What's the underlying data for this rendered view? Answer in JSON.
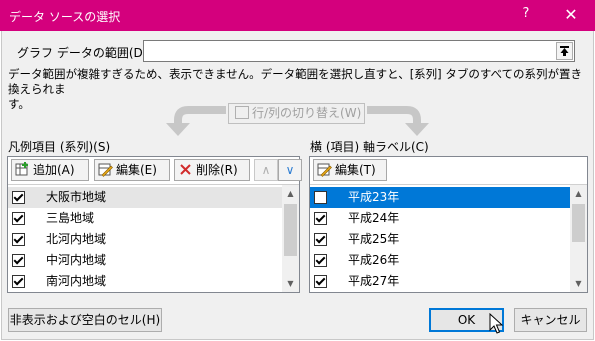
{
  "window": {
    "title": "データ ソースの選択",
    "help_label": "?",
    "close_label": "✕"
  },
  "range": {
    "label": "グラフ データの範囲(D):",
    "value": "",
    "collapse_icon": "collapse-dialog-icon"
  },
  "warning": {
    "line1": "データ範囲が複雑すぎるため、表示できません。データ範囲を選択し直すと、[系列] タブのすべての系列が置き換えられま",
    "line2": "す。"
  },
  "switch_button": {
    "label": "行/列の切り替え(W)"
  },
  "series": {
    "label": "凡例項目 (系列)(S)",
    "add_label": "追加(A)",
    "edit_label": "編集(E)",
    "delete_label": "削除(R)",
    "up_label": "∧",
    "down_label": "∨",
    "items": [
      {
        "label": "大阪市地域",
        "checked": true
      },
      {
        "label": "三島地域",
        "checked": true
      },
      {
        "label": "北河内地域",
        "checked": true
      },
      {
        "label": "中河内地域",
        "checked": true
      },
      {
        "label": "南河内地域",
        "checked": true
      }
    ]
  },
  "categories": {
    "label": "横 (項目) 軸ラベル(C)",
    "edit_label": "編集(T)",
    "items": [
      {
        "label": "平成23年",
        "checked": false
      },
      {
        "label": "平成24年",
        "checked": true
      },
      {
        "label": "平成25年",
        "checked": true
      },
      {
        "label": "平成26年",
        "checked": true
      },
      {
        "label": "平成27年",
        "checked": true
      }
    ]
  },
  "footer": {
    "hidden_cells_label": "非表示および空白のセル(H)",
    "ok_label": "OK",
    "cancel_label": "キャンセル"
  },
  "colors": {
    "titlebar": "#d4007d",
    "selection": "#0078d7"
  }
}
